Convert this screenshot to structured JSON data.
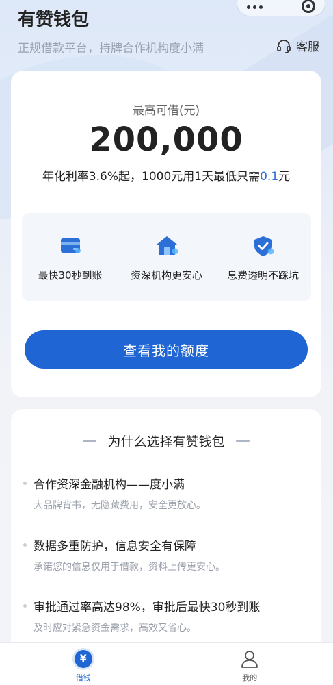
{
  "header": {
    "title": "有赞钱包",
    "subtitle": "正规借款平台，持牌合作机构度小满",
    "service_label": "客服"
  },
  "loan_card": {
    "limit_label": "最高可借(元)",
    "limit_amount": "200,000",
    "rate_prefix": "年化利率3.6%起，1000元用1天最低只需",
    "rate_highlight": "0.1",
    "rate_suffix": "元",
    "features": [
      {
        "icon": "card-icon",
        "label": "最快30秒到账"
      },
      {
        "icon": "house-icon",
        "label": "资深机构更安心"
      },
      {
        "icon": "shield-icon",
        "label": "息费透明不踩坑"
      }
    ],
    "cta_label": "查看我的额度"
  },
  "why": {
    "title": "为什么选择有赞钱包",
    "items": [
      {
        "title": "合作资深金融机构——度小满",
        "desc": "大品牌背书，无隐藏费用，安全更放心。"
      },
      {
        "title": "数据多重防护，信息安全有保障",
        "desc": "承诺您的信息仅用于借款，资料上传更安心。"
      },
      {
        "title": "审批通过率高达98%，审批后最快30秒到账",
        "desc": "及时应对紧急资金需求，高效又省心。"
      }
    ]
  },
  "tabbar": {
    "tabs": [
      {
        "label": "借钱",
        "icon": "yen-icon",
        "active": true
      },
      {
        "label": "我的",
        "icon": "user-icon",
        "active": false
      }
    ]
  },
  "colors": {
    "accent": "#1f66d4",
    "highlight": "#2c6fd7"
  }
}
